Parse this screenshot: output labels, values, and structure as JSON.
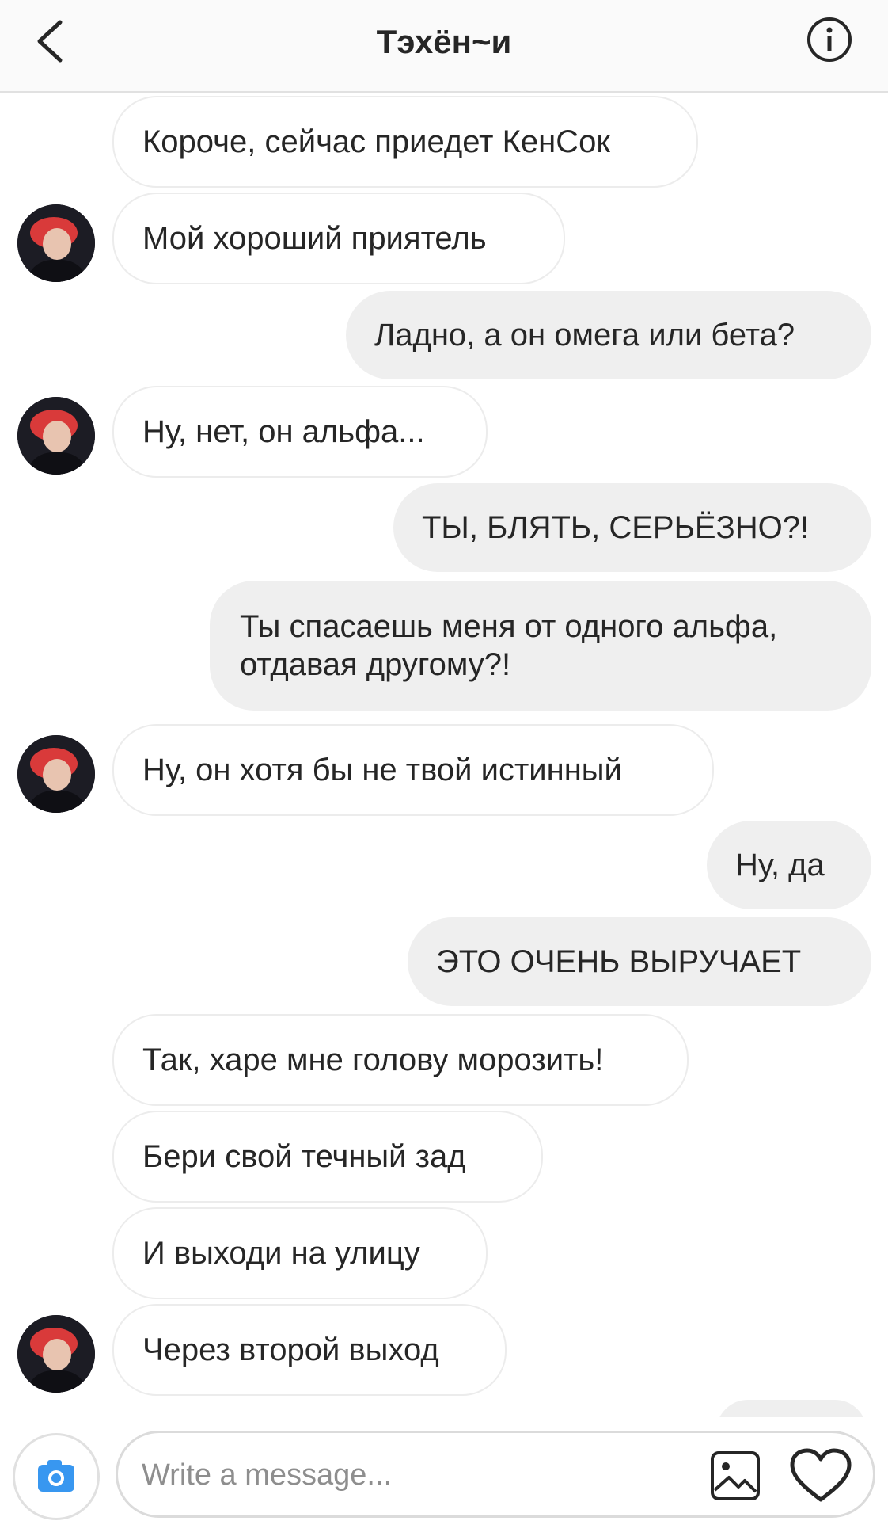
{
  "header": {
    "back_icon": "chevron-left-icon",
    "title": "Тэхён~и",
    "info_icon": "info-icon"
  },
  "messages": [
    {
      "side": "in",
      "text": "Короче, сейчас приедет КенСок",
      "avatar": false
    },
    {
      "side": "in",
      "text": "Мой хороший приятель",
      "avatar": true
    },
    {
      "side": "out",
      "text": "Ладно, а он омега или бета?"
    },
    {
      "side": "in",
      "text": "Ну, нет, он альфа...",
      "avatar": true
    },
    {
      "side": "out",
      "text": "ТЫ, БЛЯТЬ, СЕРЬЁЗНО?!"
    },
    {
      "side": "out",
      "text": "Ты спасаешь меня от одного альфа, отдавая другому?!"
    },
    {
      "side": "in",
      "text": "Ну, он хотя бы не твой истинный",
      "avatar": true
    },
    {
      "side": "out",
      "text": "Ну, да"
    },
    {
      "side": "out",
      "text": "ЭТО ОЧЕНЬ ВЫРУЧАЕТ"
    },
    {
      "side": "in",
      "text": "Так, харе мне голову морозить!",
      "avatar": false
    },
    {
      "side": "in",
      "text": "Бери свой течный зад",
      "avatar": false
    },
    {
      "side": "in",
      "text": "И выходи на улицу",
      "avatar": false
    },
    {
      "side": "in",
      "text": "Через второй выход",
      "avatar": true
    }
  ],
  "composer": {
    "camera_icon": "camera-icon",
    "placeholder": "Write a message...",
    "gallery_icon": "image-gallery-icon",
    "like_icon": "heart-icon"
  },
  "colors": {
    "outgoing_bubble": "#efefef",
    "incoming_border": "#ececec",
    "camera_accent": "#3897f0"
  }
}
